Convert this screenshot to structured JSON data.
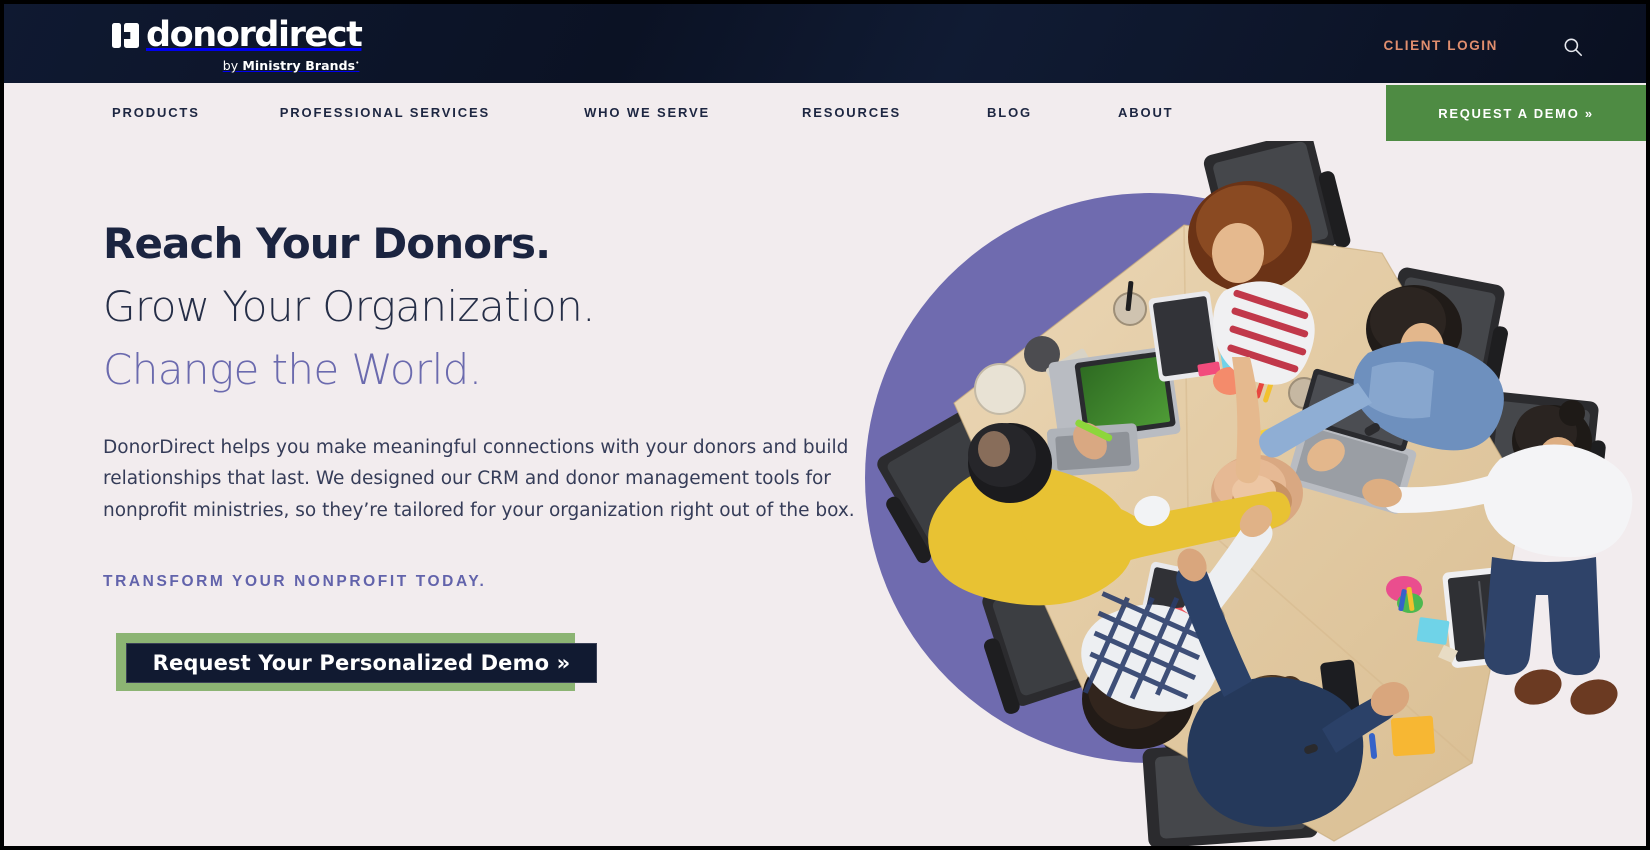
{
  "brand": {
    "logo_word": "donordirect",
    "logo_sub_prefix": "by ",
    "logo_sub_name": "Ministry Brands",
    "logo_mark_icon": "cross-blocks-icon"
  },
  "topbar": {
    "client_login_label": "CLIENT LOGIN",
    "search_icon": "search-icon",
    "background_color": "#0E1528",
    "client_login_color": "#E08E6E"
  },
  "nav": {
    "items": [
      {
        "label": "PRODUCTS"
      },
      {
        "label": "PROFESSIONAL SERVICES"
      },
      {
        "label": "WHO WE SERVE"
      },
      {
        "label": "RESOURCES"
      },
      {
        "label": "BLOG"
      },
      {
        "label": "ABOUT"
      }
    ],
    "cta_label": "REQUEST A DEMO »",
    "cta_color": "#4E8B43",
    "background_color": "#F2ECEE",
    "text_color": "#1D2641"
  },
  "hero": {
    "headline_line1": "Reach Your Donors.",
    "headline_line2": "Grow Your Organization.",
    "headline_line3": "Change the World.",
    "headline_line1_color": "#1B2440",
    "headline_line2_color": "#252E47",
    "headline_line3_color": "#6B6AAE",
    "paragraph": "DonorDirect helps you make meaningful connections with your donors and build relationships that last. We designed our CRM and donor management tools for nonprofit ministries, so they’re tailored for your organization right out of the box.",
    "eyebrow": "TRANSFORM YOUR NONPROFIT TODAY.",
    "eyebrow_color": "#6263AB",
    "cta_label": "Request Your Personalized Demo »",
    "cta_background": "#111A31",
    "cta_accent": "#8CB473",
    "background_color": "#F2ECEE",
    "artwork": {
      "circle_color": "#6F6BAF",
      "description": "Overhead photo of six coworkers at a light wood conference table joining hands in the center, laptops, tablets, phone and sticky notes on the table, black mesh office chairs around it, set on a purple circle."
    }
  }
}
